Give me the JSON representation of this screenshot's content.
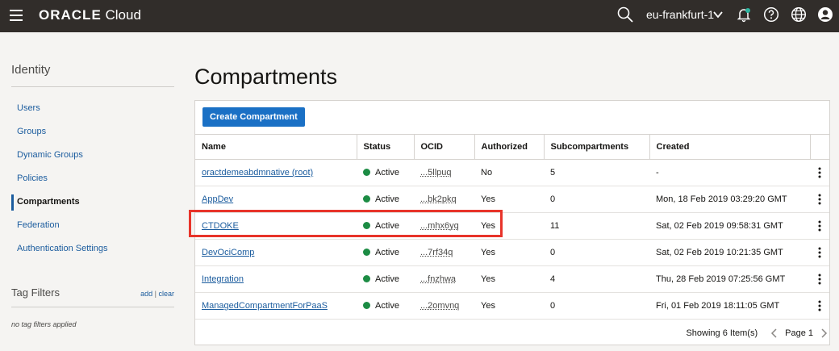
{
  "topbar": {
    "brand_bold": "ORACLE",
    "brand_rest": " Cloud",
    "region": "eu-frankfurt-1",
    "icons": [
      "menu-icon",
      "search-icon",
      "chevron-down-icon",
      "bell-icon",
      "help-icon",
      "globe-icon",
      "user-icon"
    ]
  },
  "sidebar": {
    "title": "Identity",
    "items": [
      {
        "label": "Users"
      },
      {
        "label": "Groups"
      },
      {
        "label": "Dynamic Groups"
      },
      {
        "label": "Policies"
      },
      {
        "label": "Compartments",
        "active": true
      },
      {
        "label": "Federation"
      },
      {
        "label": "Authentication Settings"
      }
    ],
    "tag_filters": {
      "title": "Tag Filters",
      "add": "add",
      "separator": "|",
      "clear": "clear",
      "empty": "no tag filters applied"
    }
  },
  "main": {
    "title": "Compartments",
    "create_button": "Create Compartment",
    "columns": [
      "Name",
      "Status",
      "OCID",
      "Authorized",
      "Subcompartments",
      "Created"
    ],
    "rows": [
      {
        "name": "oractdemeabdmnative (root)",
        "status": "Active",
        "ocid": "...5llpuq",
        "authorized": "No",
        "sub": "5",
        "created": "-"
      },
      {
        "name": "AppDev",
        "status": "Active",
        "ocid": "...bk2pkq",
        "authorized": "Yes",
        "sub": "0",
        "created": "Mon, 18 Feb 2019 03:29:20 GMT"
      },
      {
        "name": "CTDOKE",
        "status": "Active",
        "ocid": "...mhx6yq",
        "authorized": "Yes",
        "sub": "11",
        "created": "Sat, 02 Feb 2019 09:58:31 GMT"
      },
      {
        "name": "DevOciComp",
        "status": "Active",
        "ocid": "...7rf34q",
        "authorized": "Yes",
        "sub": "0",
        "created": "Sat, 02 Feb 2019 10:21:35 GMT"
      },
      {
        "name": "Integration",
        "status": "Active",
        "ocid": "...fnzhwa",
        "authorized": "Yes",
        "sub": "4",
        "created": "Thu, 28 Feb 2019 07:25:56 GMT"
      },
      {
        "name": "ManagedCompartmentForPaaS",
        "status": "Active",
        "ocid": "...2omvnq",
        "authorized": "Yes",
        "sub": "0",
        "created": "Fri, 01 Feb 2019 18:11:05 GMT"
      }
    ],
    "footer": {
      "showing": "Showing 6 Item(s)",
      "page": "Page 1"
    },
    "colors": {
      "accent": "#1a70c5",
      "active_status": "#1c8c44",
      "highlight": "#e8342a",
      "topbar": "#312d2a"
    }
  }
}
